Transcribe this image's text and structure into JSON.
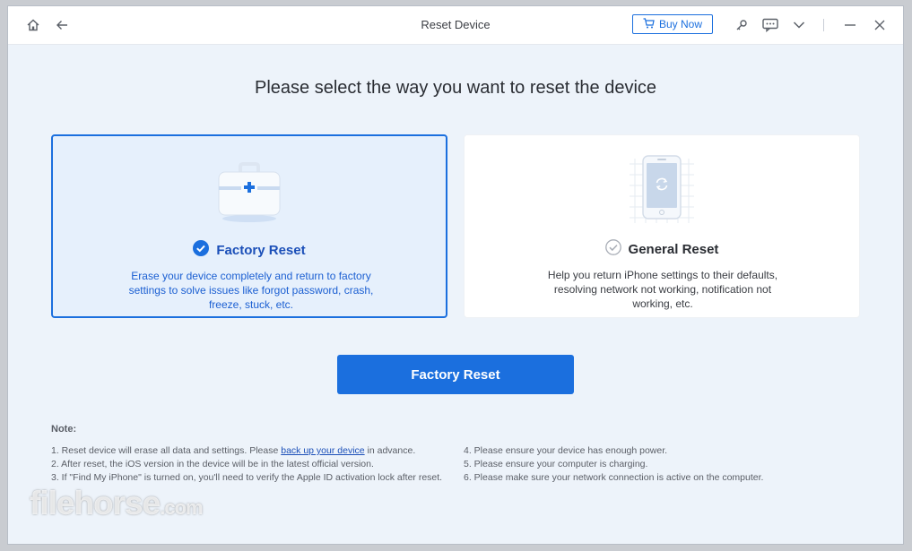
{
  "window": {
    "title": "Reset Device",
    "buy_button_label": "Buy Now"
  },
  "icons": {
    "home": "home-icon",
    "back": "arrow-left-icon",
    "cart": "cart-icon",
    "key": "key-icon",
    "feedback": "message-icon",
    "dropdown": "chevron-down-icon",
    "minimize": "minimize-icon",
    "close": "close-icon"
  },
  "main": {
    "heading": "Please select the way you want to reset the device",
    "options": [
      {
        "title": "Factory Reset",
        "description": "Erase your device completely and return to factory settings to solve issues like forgot password, crash, freeze, stuck, etc.",
        "selected": true,
        "icon": "toolbox-icon"
      },
      {
        "title": "General Reset",
        "description": "Help you return iPhone settings to their defaults, resolving network not working, notification not working, etc.",
        "selected": false,
        "icon": "phone-refresh-icon"
      }
    ],
    "action_button_label": "Factory Reset"
  },
  "notes": {
    "title": "Note:",
    "left": [
      {
        "prefix": "1. Reset device will erase all data and settings. Please ",
        "link": "back up your device",
        "suffix": " in advance."
      },
      {
        "text": "2. After reset, the iOS version in the device will be in the latest official version."
      },
      {
        "text": "3. If \"Find My iPhone\" is turned on, you'll need to verify the Apple ID activation lock after reset."
      }
    ],
    "right": [
      "4. Please ensure your device has enough power.",
      "5. Please ensure your computer is charging.",
      "6. Please make sure your network connection is active on the computer."
    ]
  },
  "watermark": {
    "main": "filehorse",
    "suffix": ".com"
  },
  "colors": {
    "accent": "#1b6fde",
    "selected_bg": "#e6f0fc",
    "window_bg": "#edf3fa"
  }
}
